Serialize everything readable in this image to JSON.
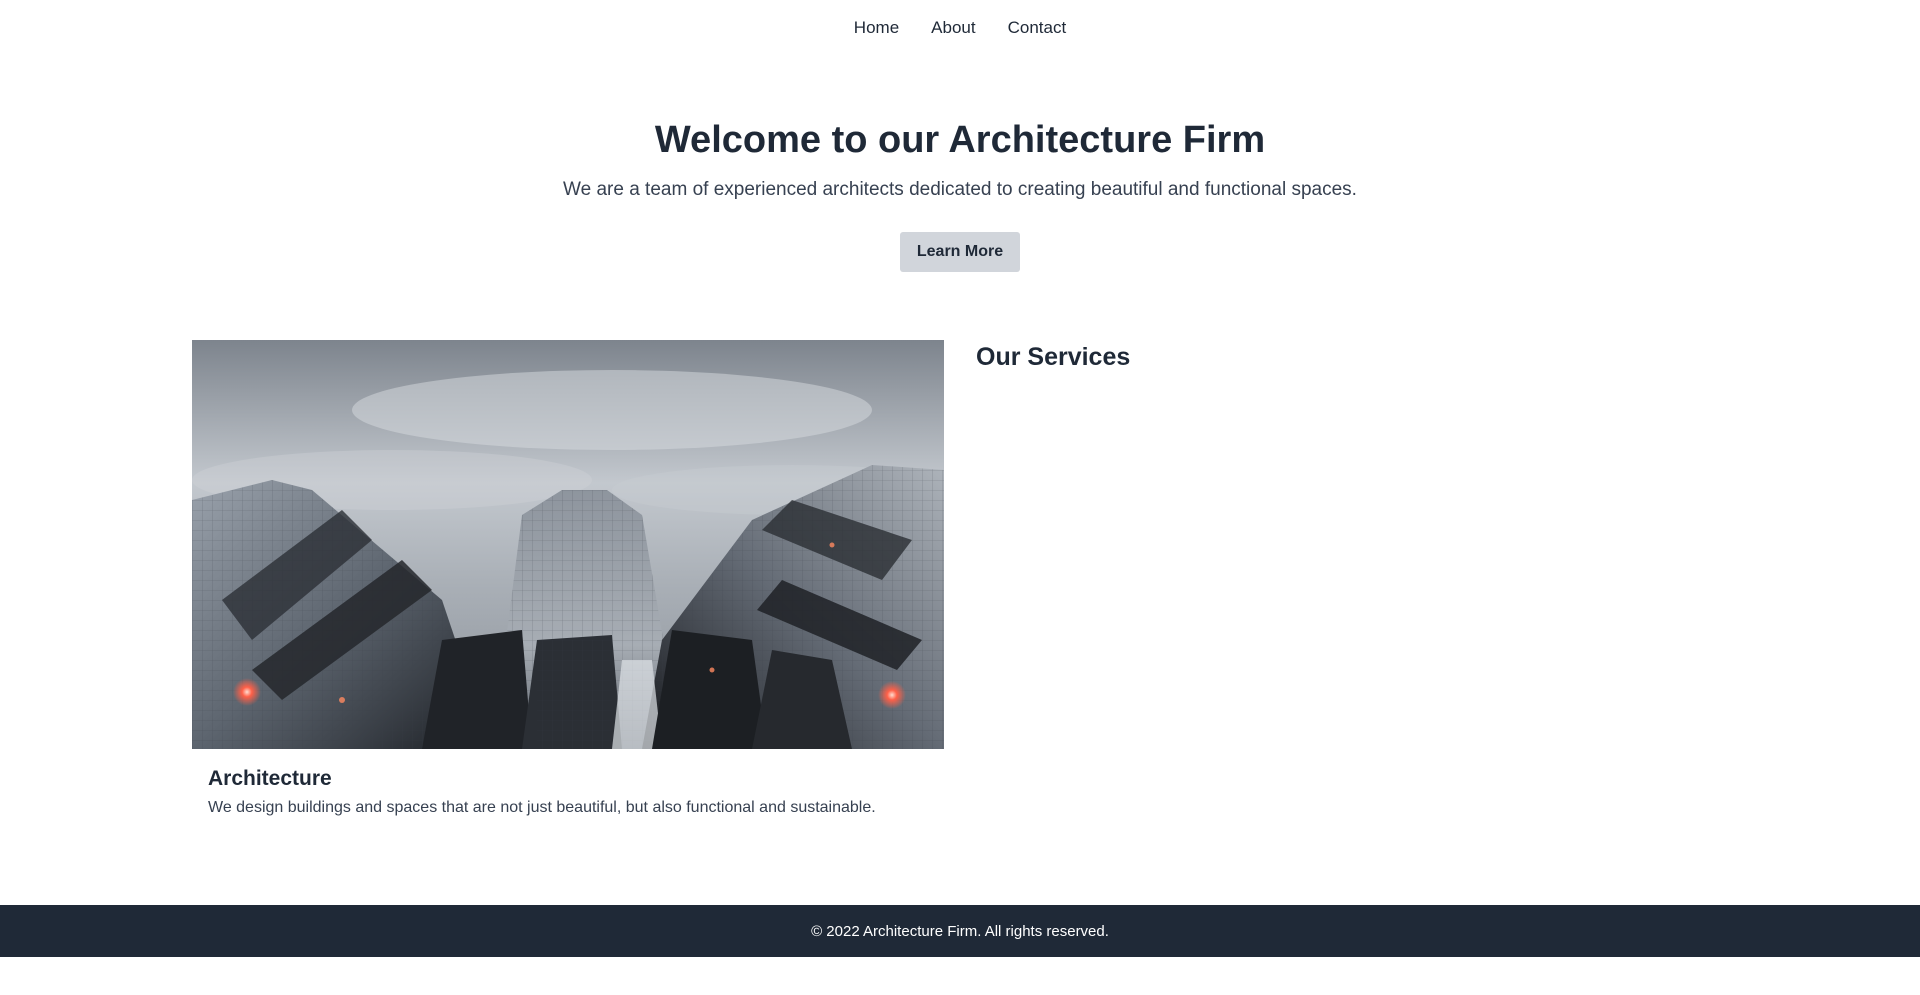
{
  "nav": {
    "items": [
      {
        "label": "Home"
      },
      {
        "label": "About"
      },
      {
        "label": "Contact"
      }
    ]
  },
  "hero": {
    "title": "Welcome to our Architecture Firm",
    "subtitle": "We are a team of experienced architects dedicated to creating beautiful and functional spaces.",
    "button_label": "Learn More"
  },
  "card": {
    "image_subject": "skyscrapers-photo",
    "title": "Architecture",
    "text": "We design buildings and spaces that are not just beautiful, but also functional and sustainable."
  },
  "services": {
    "heading": "Our Services"
  },
  "footer": {
    "text": "© 2022 Architecture Firm. All rights reserved."
  },
  "colors": {
    "text": "#1f2937",
    "button_bg": "#d1d5db",
    "footer_bg": "#1f2937"
  }
}
